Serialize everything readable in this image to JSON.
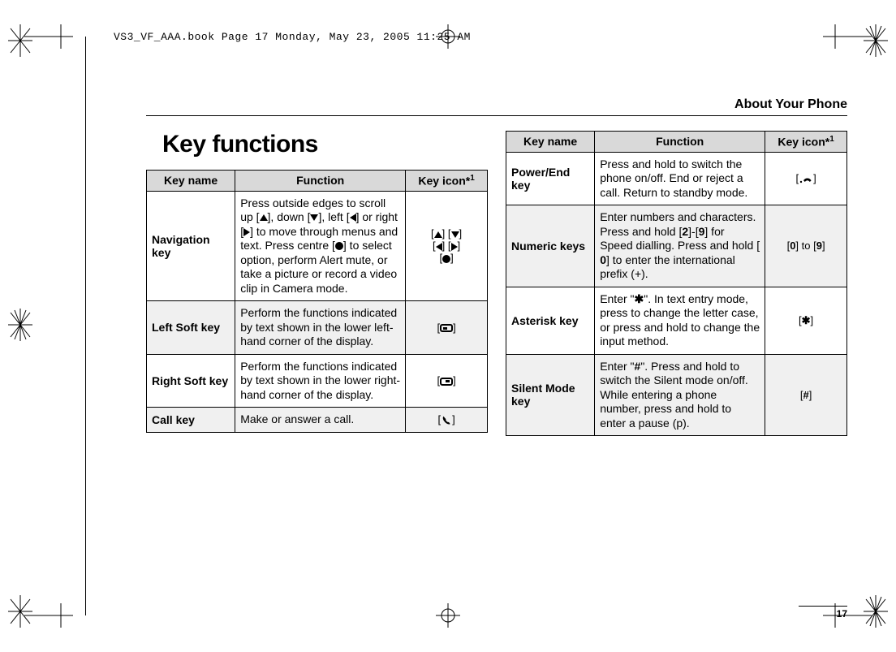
{
  "doc_header": "VS3_VF_AAA.book  Page 17  Monday, May 23, 2005  11:25 AM",
  "running_head": "About Your Phone",
  "section_title": "Key functions",
  "page_number": "17",
  "table_headers": {
    "name": "Key name",
    "func": "Function",
    "icon_prefix": "Key icon*",
    "icon_sup": "1"
  },
  "left_rows": [
    {
      "name": "Navigation key",
      "func": "Press outside edges to scroll up [▲], down [▼], left [◀] or right [▶] to move through menus and text. Press centre [●] to select option, perform Alert mute, or take a picture or record a video clip in Camera mode.",
      "icon_html": "[▲] [▼]<br>[◀] [▶]<br>[●]",
      "icon_kind": "nav"
    },
    {
      "name": "Left Soft key",
      "func": "Perform the functions indicated by text shown in the lower left-hand corner of the display.",
      "icon_kind": "softleft"
    },
    {
      "name": "Right Soft key",
      "func": "Perform the functions indicated by text shown in the lower right-hand corner of the display.",
      "icon_kind": "softright"
    },
    {
      "name": "Call key",
      "func": "Make or answer a call.",
      "icon_kind": "call"
    }
  ],
  "right_rows": [
    {
      "name": "Power/End key",
      "func": "Press and hold to switch the phone on/off. End or reject a call. Return to standby mode.",
      "icon_kind": "end"
    },
    {
      "name": "Numeric keys",
      "func": "Enter numbers and characters. Press and hold [2]-[9] for Speed dialling. Press and hold [0] to enter the international prefix (+).",
      "icon_kind": "numeric",
      "icon_text": "[0] to [9]"
    },
    {
      "name": "Asterisk key",
      "func": "Enter \"✱\". In text entry mode, press to change the letter case, or press and hold to change the input method.",
      "icon_kind": "asterisk",
      "icon_text": "[✱]"
    },
    {
      "name": "Silent Mode key",
      "func": "Enter \"#\". Press and hold to switch the Silent mode on/off. While entering a phone number, press and hold to enter a pause (p).",
      "icon_kind": "hash",
      "icon_text": "[#]"
    }
  ]
}
